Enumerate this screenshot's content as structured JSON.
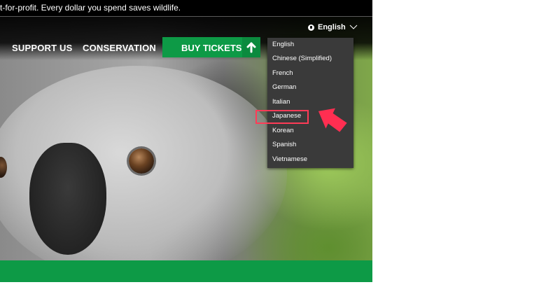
{
  "topbar": {
    "text": "t-for-profit. Every dollar you spend saves wildlife."
  },
  "header": {
    "nav": {
      "support": "SUPPORT US",
      "conservation": "CONSERVATION"
    },
    "buy_tickets": "BUY TICKETS",
    "language": {
      "current": "English",
      "icon": "globe-icon"
    }
  },
  "dropdown": {
    "items": [
      "English",
      "Chinese (Simplified)",
      "French",
      "German",
      "Italian",
      "Japanese",
      "Korean",
      "Spanish",
      "Vietnamese"
    ],
    "highlighted": "Japanese"
  },
  "colors": {
    "brand_green": "#0d9a46",
    "dropdown_bg": "#3a3a3a",
    "highlight": "#ff3b57"
  }
}
